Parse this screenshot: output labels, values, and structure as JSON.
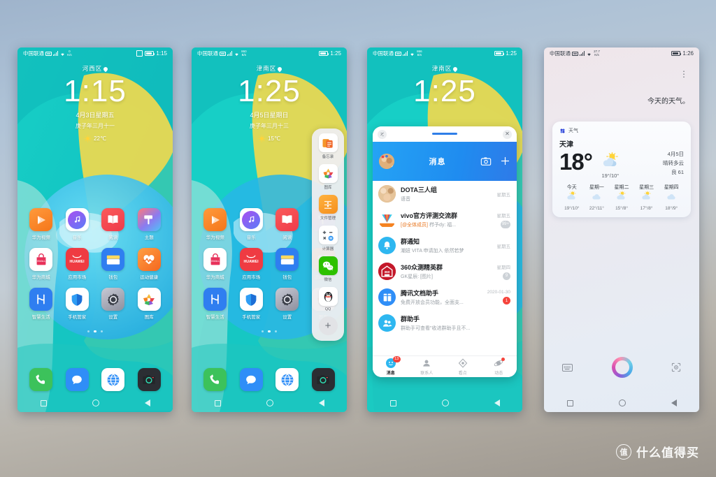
{
  "watermark": {
    "badge": "值",
    "text": "什么值得买"
  },
  "common": {
    "carrier": "中国联通",
    "nav": {
      "recent": "recent-apps",
      "home": "home",
      "back": "back"
    }
  },
  "phones": [
    {
      "id": "phone1",
      "status": {
        "carrier": "中国联通",
        "netspeed_value": "0",
        "netspeed_unit": "K/s",
        "time": "1:15"
      },
      "lock": {
        "location": "河西区",
        "clock": "1:15",
        "date": "4月3日星期五",
        "lunar": "庚子年三月十一",
        "weather_temp": "22℃"
      },
      "apps": [
        {
          "label": "华为视频",
          "icon": "huawei-video-icon"
        },
        {
          "label": "音乐",
          "icon": "music-icon"
        },
        {
          "label": "阅读",
          "icon": "reading-icon"
        },
        {
          "label": "主题",
          "icon": "themes-icon"
        },
        {
          "label": "华为商城",
          "icon": "vmall-icon"
        },
        {
          "label": "应用市场",
          "icon": "appgallery-icon"
        },
        {
          "label": "钱包",
          "icon": "wallet-icon"
        },
        {
          "label": "运动健康",
          "icon": "health-icon"
        },
        {
          "label": "智慧生活",
          "icon": "smart-life-icon"
        },
        {
          "label": "手机管家",
          "icon": "phone-manager-icon"
        },
        {
          "label": "设置",
          "icon": "settings-icon"
        },
        {
          "label": "图库",
          "icon": "gallery-icon"
        }
      ],
      "dock": [
        {
          "label": "phone",
          "icon": "phone-icon"
        },
        {
          "label": "messages",
          "icon": "messages-icon"
        },
        {
          "label": "browser",
          "icon": "browser-icon"
        },
        {
          "label": "camera",
          "icon": "camera-icon"
        }
      ],
      "page_dots": 3,
      "page_active": 1
    },
    {
      "id": "phone2",
      "status": {
        "carrier": "中国联通",
        "netspeed_value": "860",
        "netspeed_unit": "B/s",
        "time": "1:25"
      },
      "lock": {
        "location": "津南区",
        "clock": "1:25",
        "date": "4月5日星期日",
        "lunar": "庚子年三月十三",
        "weather_temp": "15℃"
      },
      "sidepanel": [
        {
          "label": "备忘录",
          "icon": "notepad-icon"
        },
        {
          "label": "图库",
          "icon": "gallery-icon"
        },
        {
          "label": "文件管理",
          "icon": "file-manager-icon"
        },
        {
          "label": "计算器",
          "icon": "calculator-icon"
        },
        {
          "label": "微信",
          "icon": "wechat-icon"
        },
        {
          "label": "QQ",
          "icon": "qq-icon"
        }
      ],
      "sidepanel_add": "+"
    },
    {
      "id": "phone3",
      "status": {
        "carrier": "中国联通",
        "netspeed_value": "866",
        "netspeed_unit": "B/s",
        "time": "1:25"
      },
      "lock": {
        "location": "津南区",
        "clock": "1:25"
      },
      "qq": {
        "header_title": "消息",
        "camera_icon": "camera-icon",
        "add_icon": "plus-icon",
        "close_icon": "close-icon",
        "rows": [
          {
            "name": "DOTA三人组",
            "msg": "语音",
            "time": "星期五",
            "badge": "",
            "badge_grey": false,
            "icon": "group-avatar"
          },
          {
            "name": "vivo官方评测交流群",
            "msg_at": "[@全体成员]",
            "msg": " 栉予dy: 福...",
            "time": "星期五",
            "badge": "99+",
            "badge_grey": true,
            "icon": "vivo-icon"
          },
          {
            "name": "群通知",
            "msg": "潮妞 VITA 申请加入 依然若梦",
            "time": "星期五",
            "badge": "",
            "badge_grey": false,
            "icon": "bell-icon"
          },
          {
            "name": "360众测精英群",
            "msg": "GK星辰: [图片]",
            "time": "星期四",
            "badge": "9",
            "badge_grey": true,
            "icon": "360-icon"
          },
          {
            "name": "腾讯文档助手",
            "msg": "免费开放会员功能，全面支...",
            "time": "2020-01-30",
            "badge": "1",
            "badge_grey": false,
            "icon": "docs-icon"
          },
          {
            "name": "群助手",
            "msg": "群助手可查看\"收进群助手且不...",
            "time": "",
            "badge": "",
            "badge_grey": false,
            "icon": "group-helper-icon"
          }
        ],
        "tabs": [
          {
            "label": "消息",
            "active": true,
            "badge": "13",
            "dot": false,
            "icon": "message-tab-icon"
          },
          {
            "label": "联系人",
            "active": false,
            "badge": "",
            "dot": false,
            "icon": "contacts-tab-icon"
          },
          {
            "label": "看点",
            "active": false,
            "badge": "",
            "dot": false,
            "icon": "kandian-tab-icon"
          },
          {
            "label": "动态",
            "active": false,
            "badge": "",
            "dot": true,
            "icon": "moments-tab-icon"
          }
        ]
      }
    },
    {
      "id": "phone4",
      "status": {
        "carrier": "中国联通",
        "netspeed_value": "27.7",
        "netspeed_unit": "K/s",
        "time": "1:26"
      },
      "assistant": {
        "more_icon": "more-vertical-icon",
        "user_query": "今天的天气。",
        "keyboard_icon": "keyboard-icon",
        "orb_icon": "assistant-orb-icon",
        "scan_icon": "scan-icon",
        "weather_card": {
          "source": "天气",
          "source_icon": "weather-source-icon",
          "city": "天津",
          "temp": "18°",
          "range": "19°/10°",
          "date": "4月5日",
          "condition": "晴转多云",
          "air": "良 61",
          "forecast": [
            {
              "day": "今天",
              "icon": "sun-cloud-icon",
              "range": "19°/10°"
            },
            {
              "day": "星期一",
              "icon": "cloud-icon",
              "range": "22°/11°"
            },
            {
              "day": "星期二",
              "icon": "sun-cloud-icon",
              "range": "15°/8°"
            },
            {
              "day": "星期三",
              "icon": "sun-cloud-icon",
              "range": "17°/8°"
            },
            {
              "day": "星期四",
              "icon": "cloud-icon",
              "range": "18°/9°"
            }
          ]
        }
      }
    }
  ]
}
